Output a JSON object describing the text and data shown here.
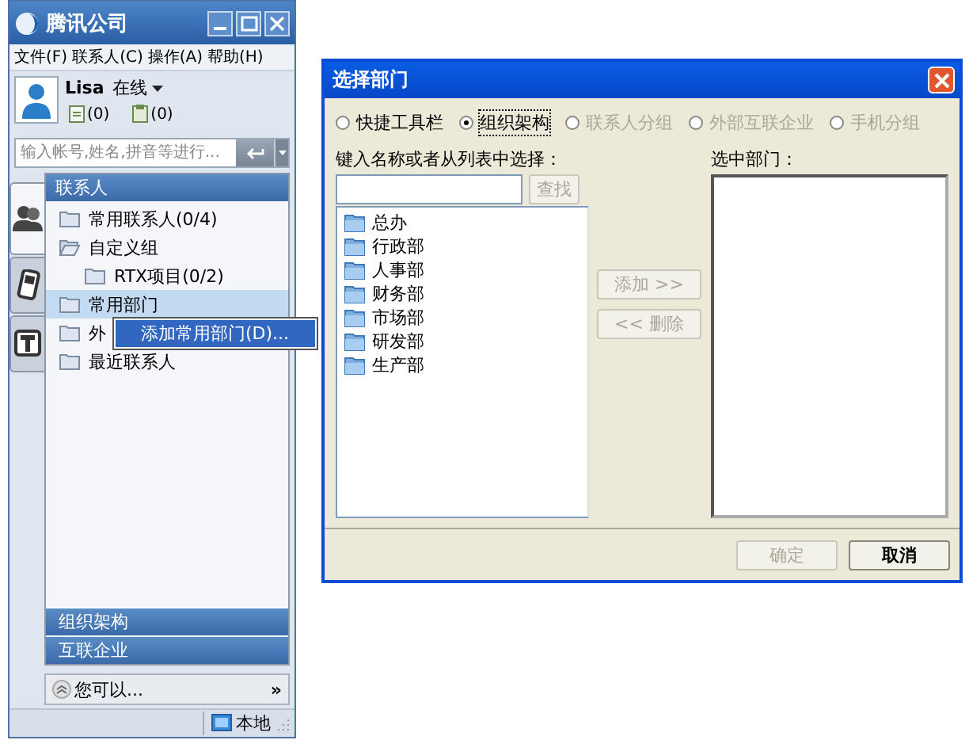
{
  "client": {
    "title": "腾讯公司",
    "menu": [
      "文件(F)",
      "联系人(C)",
      "操作(A)",
      "帮助(H)"
    ],
    "user": {
      "name": "Lisa",
      "status": "在线"
    },
    "counters": [
      "(0)",
      "(0)"
    ],
    "search": {
      "placeholder": "输入帐号,姓名,拼音等进行..."
    },
    "side_tabs": [
      {
        "kind": "contacts",
        "selected": true
      },
      {
        "kind": "phone",
        "selected": false
      },
      {
        "kind": "text",
        "selected": false
      }
    ],
    "panel_header": "联系人",
    "tree": [
      {
        "label": "常用联系人(0/4)",
        "expanded": false,
        "selected": false
      },
      {
        "label": "自定义组",
        "expanded": true,
        "selected": false,
        "children": [
          {
            "label": "RTX项目(0/2)",
            "expanded": false,
            "selected": false
          }
        ]
      },
      {
        "label": "常用部门",
        "expanded": false,
        "selected": true
      },
      {
        "label": "外",
        "expanded": false,
        "selected": false
      },
      {
        "label": "最近联系人",
        "expanded": false,
        "selected": false
      }
    ],
    "context_menu": [
      "添加常用部门(D)..."
    ],
    "bottom_panels": [
      "组织架构",
      "互联企业"
    ],
    "hint": "您可以...",
    "hint_more": "»",
    "status": "本地"
  },
  "dialog": {
    "title": "选择部门",
    "radios": [
      {
        "label": "快捷工具栏",
        "selected": false,
        "disabled": false
      },
      {
        "label": "组织架构",
        "selected": true,
        "disabled": false
      },
      {
        "label": "联系人分组",
        "selected": false,
        "disabled": true
      },
      {
        "label": "外部互联企业",
        "selected": false,
        "disabled": true
      },
      {
        "label": "手机分组",
        "selected": false,
        "disabled": true
      }
    ],
    "list_label": "键入名称或者从列表中选择：",
    "find_button": {
      "label": "查找",
      "disabled": true
    },
    "departments": [
      "总办",
      "行政部",
      "人事部",
      "财务部",
      "市场部",
      "研发部",
      "生产部"
    ],
    "add_button": {
      "label": "添加 >>",
      "disabled": true
    },
    "remove_button": {
      "label": "<< 删除",
      "disabled": true
    },
    "selected_label": "选中部门：",
    "ok_button": {
      "label": "确定",
      "disabled": true
    },
    "cancel_button": {
      "label": "取消",
      "disabled": false
    }
  }
}
